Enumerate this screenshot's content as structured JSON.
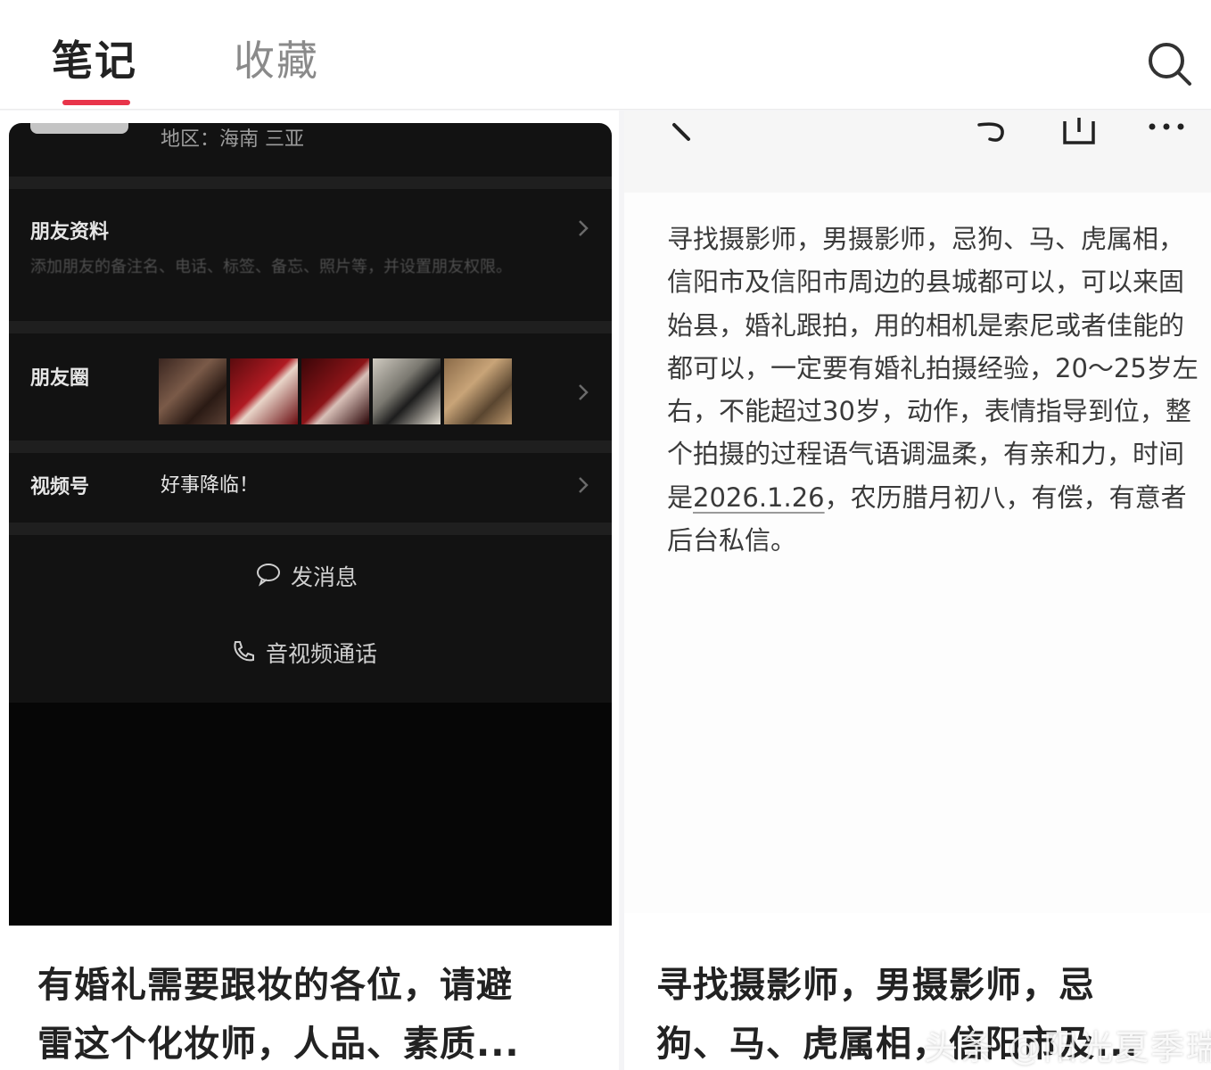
{
  "header": {
    "tabs": [
      {
        "label": "笔记",
        "active": true
      },
      {
        "label": "收藏",
        "active": false
      }
    ],
    "search_icon": "search-icon",
    "accent_color": "#e8344a"
  },
  "left_card": {
    "screenshot": {
      "region": "地区：海南 三亚",
      "friend_info_label": "朋友资料",
      "friend_info_desc": "添加朋友的备注名、电话、标签、备忘、照片等，并设置朋友权限。",
      "moments_label": "朋友圈",
      "channels_label": "视频号",
      "channels_value": "好事降临！",
      "send_message": "发消息",
      "av_call": "音视频通话"
    },
    "caption_line1": "有婚礼需要跟妆的各位，请避",
    "caption_line2": "雷这个化妆师，人品、素质..."
  },
  "right_card": {
    "screenshot": {
      "body_before_date": "寻找摄影师，男摄影师，忌狗、马、虎属相，信阳市及信阳市周边的县城都可以，可以来固始县，婚礼跟拍，用的相机是索尼或者佳能的都可以，一定要有婚礼拍摄经验，20～25岁左右，不能超过30岁，动作，表情指导到位，整个拍摄的过程语气语调温柔，有亲和力，时间是",
      "body_date": "2026.1.26",
      "body_after_date": "，农历腊月初八，有偿，有意者后台私信。"
    },
    "caption_line1": "寻找摄影师，男摄影师，忌",
    "caption_line2": "狗、马、虎属相，信阳市及..."
  },
  "watermark": "头条 @阳光夏季瑞金"
}
